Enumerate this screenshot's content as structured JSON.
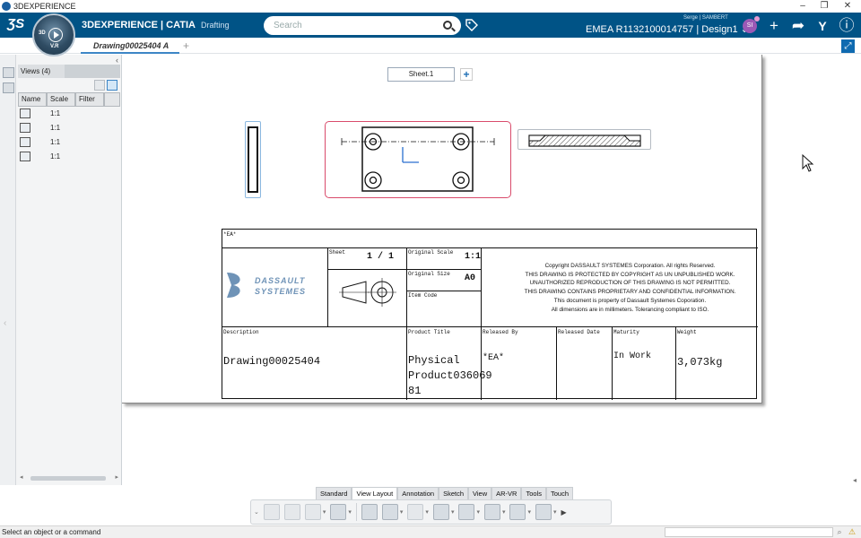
{
  "window": {
    "title": "3DEXPERIENCE"
  },
  "header": {
    "brand_main": "3DEXPERIENCE | CATIA",
    "brand_app": "Drafting",
    "compass_label": "3D",
    "compass_version": "V.R",
    "search_placeholder": "Search",
    "user_name": "Serge | SAMBERT",
    "user_initials": "SI",
    "tenant_label": "EMEA R1132100014757 | Design1 ⌄"
  },
  "tabs": {
    "document": "Drawing00025404 A",
    "add": "+"
  },
  "tree_panel": {
    "tab_label": "Views (4)",
    "columns": [
      "Name",
      "Scale",
      "Filter"
    ],
    "rows": [
      {
        "icon": "front-view-icon",
        "scale": "1:1"
      },
      {
        "icon": "section-view-icon",
        "scale": "1:1"
      },
      {
        "icon": "isometric-view-icon",
        "scale": "1:1"
      },
      {
        "icon": "projection-view-icon",
        "scale": "1:1"
      }
    ]
  },
  "sheet": {
    "tab": "Sheet.1"
  },
  "title_block": {
    "top_label": "*EA*",
    "sheet_label": "Sheet",
    "sheet_value": "1 / 1",
    "original_scale_label": "Original Scale",
    "original_scale_value": "1:1",
    "original_size_label": "Original Size",
    "original_size_value": "A0",
    "item_code_label": "Item Code",
    "copyright": [
      "Copyright DASSAULT SYSTEMES Corporation. All rights Reserved.",
      "THIS DRAWING IS PROTECTED BY COPYRIGHT AS UN UNPUBLISHED WORK.",
      "UNAUTHORIZED REPRODUCTION OF THIS DRAWING IS NOT PERMITTED.",
      "THIS DRAWING CONTAINS PROPRIETARY AND CONFIDENTIAL INFORMATION.",
      "This document is property of Dassault Systemes Coporation.",
      "All dimensions are in millimeters. Tolerancing compliant to ISO."
    ],
    "company_logo_text": "DASSAULT SYSTEMES",
    "description_label": "Description",
    "description_value": "Drawing00025404",
    "product_title_label": "Product Title",
    "product_title_line1": "Physical",
    "product_title_line2": "Product036069",
    "product_title_line3": "81",
    "released_by_label": "Released By",
    "released_by_value": "*EA*",
    "released_date_label": "Released Date",
    "maturity_label": "Maturity",
    "maturity_value": "In Work",
    "weight_label": "Weight",
    "weight_value": "3,073kg"
  },
  "action_bar": {
    "sections": [
      "Standard",
      "View Layout",
      "Annotation",
      "Sketch",
      "View",
      "AR-VR",
      "Tools",
      "Touch"
    ],
    "active_section": "View Layout"
  },
  "status": {
    "message": "Select an object or a command"
  },
  "colors": {
    "header_blue": "#005386",
    "selection_red": "#d94b6b",
    "preselect_blue": "#8bb8e0",
    "accent": "#3d86c6"
  }
}
